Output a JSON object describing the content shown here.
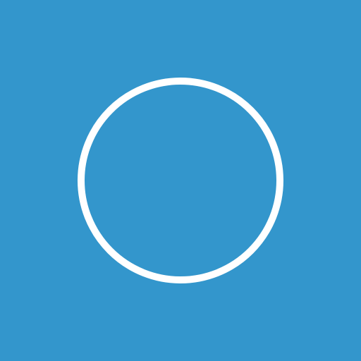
{
  "icon": {
    "name": "circle-outline-icon",
    "shape": "circle-outline",
    "background_color": "#3396cc",
    "stroke_color": "#ffffff"
  }
}
